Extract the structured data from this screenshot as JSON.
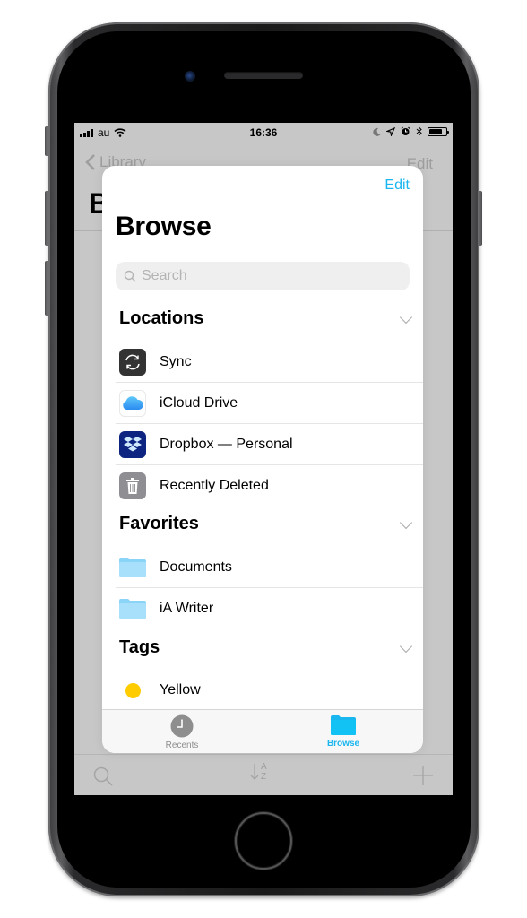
{
  "status_bar": {
    "carrier": "au",
    "time": "16:36",
    "icons": [
      "signal-icon",
      "wifi-icon",
      "moon-icon",
      "location-icon",
      "alarm-icon",
      "bluetooth-icon",
      "battery-icon"
    ],
    "battery_level": 0.75
  },
  "background": {
    "back_label": "Library",
    "edit_label": "Edit",
    "title_partial": "B",
    "toolbar": [
      "search-icon",
      "sort-az-icon",
      "add-icon"
    ],
    "sort_letters": [
      "A",
      "Z"
    ]
  },
  "modal": {
    "edit_label": "Edit",
    "title": "Browse",
    "search_placeholder": "Search",
    "sections": [
      {
        "title": "Locations",
        "items": [
          {
            "label": "Sync",
            "icon": "sync-icon"
          },
          {
            "label": "iCloud Drive",
            "icon": "icloud-icon"
          },
          {
            "label": "Dropbox — Personal",
            "icon": "dropbox-icon"
          },
          {
            "label": "Recently Deleted",
            "icon": "trash-icon"
          }
        ]
      },
      {
        "title": "Favorites",
        "items": [
          {
            "label": "Documents",
            "icon": "folder-icon"
          },
          {
            "label": "iA Writer",
            "icon": "folder-icon"
          }
        ]
      },
      {
        "title": "Tags",
        "items": [
          {
            "label": "Yellow",
            "icon": "tag-dot-icon",
            "color": "#ffcc00"
          }
        ]
      }
    ],
    "tabs": [
      {
        "label": "Recents",
        "icon": "clock-icon",
        "selected": false
      },
      {
        "label": "Browse",
        "icon": "folder-icon",
        "selected": true
      }
    ]
  },
  "colors": {
    "accent": "#1ab6ef",
    "folder": "#8ad4f8",
    "dropbox": "#0d2481",
    "sync": "#333333",
    "trash": "#8e8e93",
    "tag_yellow": "#ffcc00"
  }
}
